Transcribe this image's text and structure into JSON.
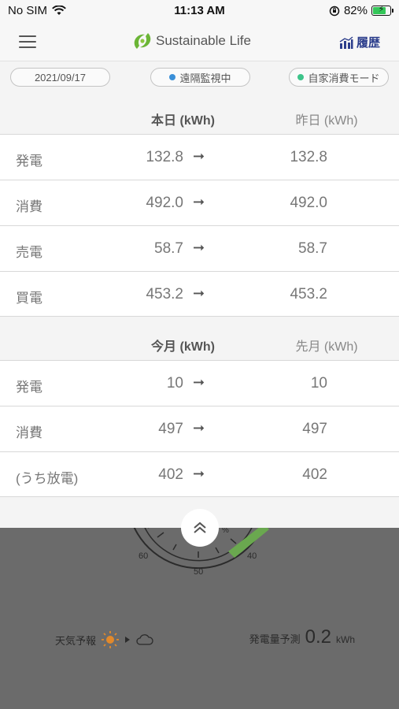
{
  "status_bar": {
    "carrier": "No SIM",
    "time": "11:13 AM",
    "battery": "82%",
    "battery_level": 0.82
  },
  "header": {
    "app_title": "Sustainable Life",
    "history_label": "履歴"
  },
  "pills": {
    "date": "2021/09/17",
    "monitor": "遠隔監視中",
    "mode": "自家消費モード",
    "monitor_color": "#3a8fd8",
    "mode_color": "#3ec48a"
  },
  "daily": {
    "col_today": "本日 (kWh)",
    "col_yesterday": "昨日 (kWh)",
    "rows": [
      {
        "label": "発電",
        "today": "132.8",
        "yesterday": "132.8"
      },
      {
        "label": "消費",
        "today": "492.0",
        "yesterday": "492.0"
      },
      {
        "label": "売電",
        "today": "58.7",
        "yesterday": "58.7"
      },
      {
        "label": "買電",
        "today": "453.2",
        "yesterday": "453.2"
      }
    ]
  },
  "monthly": {
    "col_this_month": "今月 (kWh)",
    "col_last_month": "先月 (kWh)",
    "rows": [
      {
        "label": "発電",
        "this_month": "10",
        "last_month": "10"
      },
      {
        "label": "消費",
        "this_month": "497",
        "last_month": "497"
      },
      {
        "label": "(うち放電)",
        "this_month": "402",
        "last_month": "402"
      }
    ]
  },
  "arrow_glyph": "➞",
  "gauge": {
    "tick_60": "60",
    "tick_50": "50",
    "tick_40": "40",
    "partial": "%"
  },
  "forecast": {
    "weather_label": "天気予報",
    "prediction_label": "発電量予測",
    "prediction_value": "0.2",
    "prediction_unit": "kWh"
  },
  "colors": {
    "accent": "#2c3e8c",
    "logo_green": "#6bb536",
    "gauge_green": "#6aa84f"
  }
}
